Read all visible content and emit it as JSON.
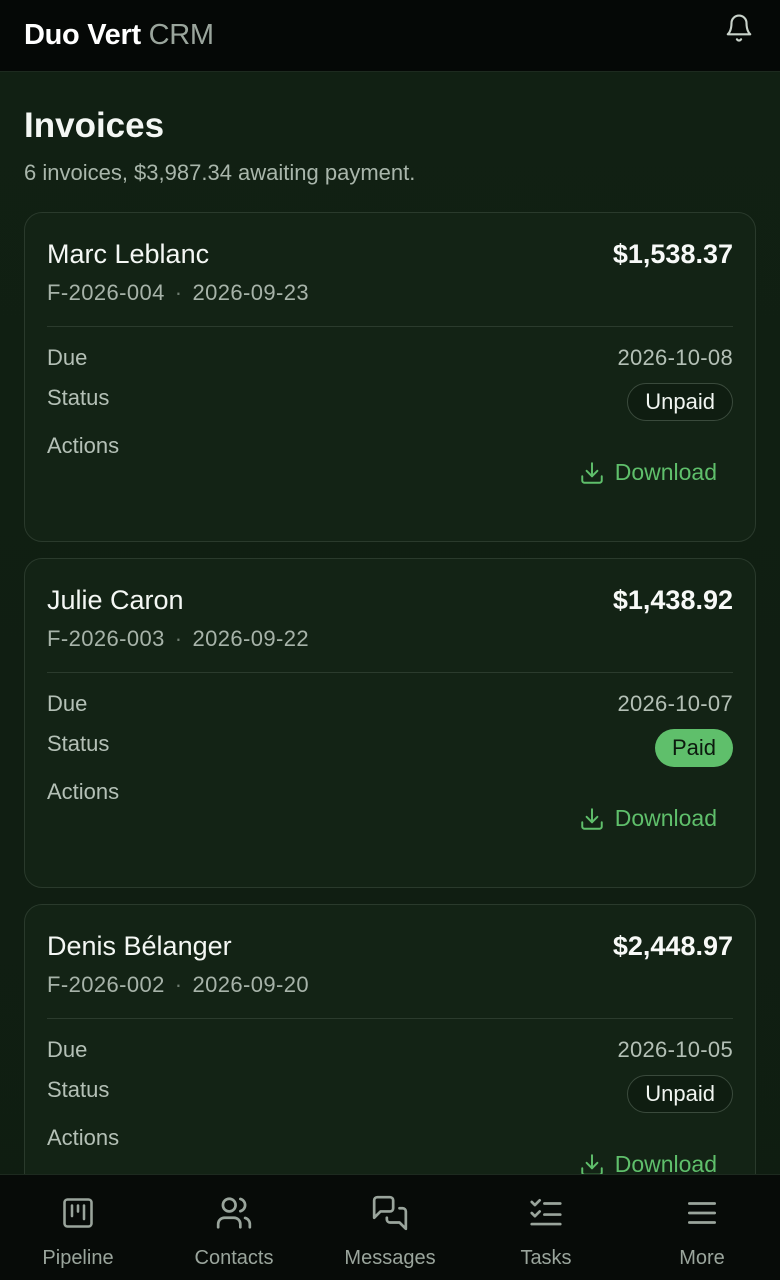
{
  "header": {
    "brand_primary": "Duo Vert",
    "brand_secondary": "CRM",
    "bell_icon": "bell-icon"
  },
  "page": {
    "title": "Invoices",
    "summary": "6 invoices, $3,987.34 awaiting payment."
  },
  "labels": {
    "due": "Due",
    "status": "Status",
    "actions": "Actions",
    "download": "Download"
  },
  "invoices": [
    {
      "client": "Marc Leblanc",
      "amount": "$1,538.37",
      "number": "F-2026-004",
      "date": "2026-09-23",
      "due": "2026-10-08",
      "status": "Unpaid"
    },
    {
      "client": "Julie Caron",
      "amount": "$1,438.92",
      "number": "F-2026-003",
      "date": "2026-09-22",
      "due": "2026-10-07",
      "status": "Paid"
    },
    {
      "client": "Denis Bélanger",
      "amount": "$2,448.97",
      "number": "F-2026-002",
      "date": "2026-09-20",
      "due": "2026-10-05",
      "status": "Unpaid"
    }
  ],
  "nav": [
    {
      "label": "Pipeline",
      "icon": "pipeline-icon"
    },
    {
      "label": "Contacts",
      "icon": "contacts-icon"
    },
    {
      "label": "Messages",
      "icon": "messages-icon"
    },
    {
      "label": "Tasks",
      "icon": "tasks-icon"
    },
    {
      "label": "More",
      "icon": "menu-icon"
    }
  ],
  "colors": {
    "accent": "#5fbf6b",
    "background": "#0f1d11",
    "card": "#132315"
  }
}
